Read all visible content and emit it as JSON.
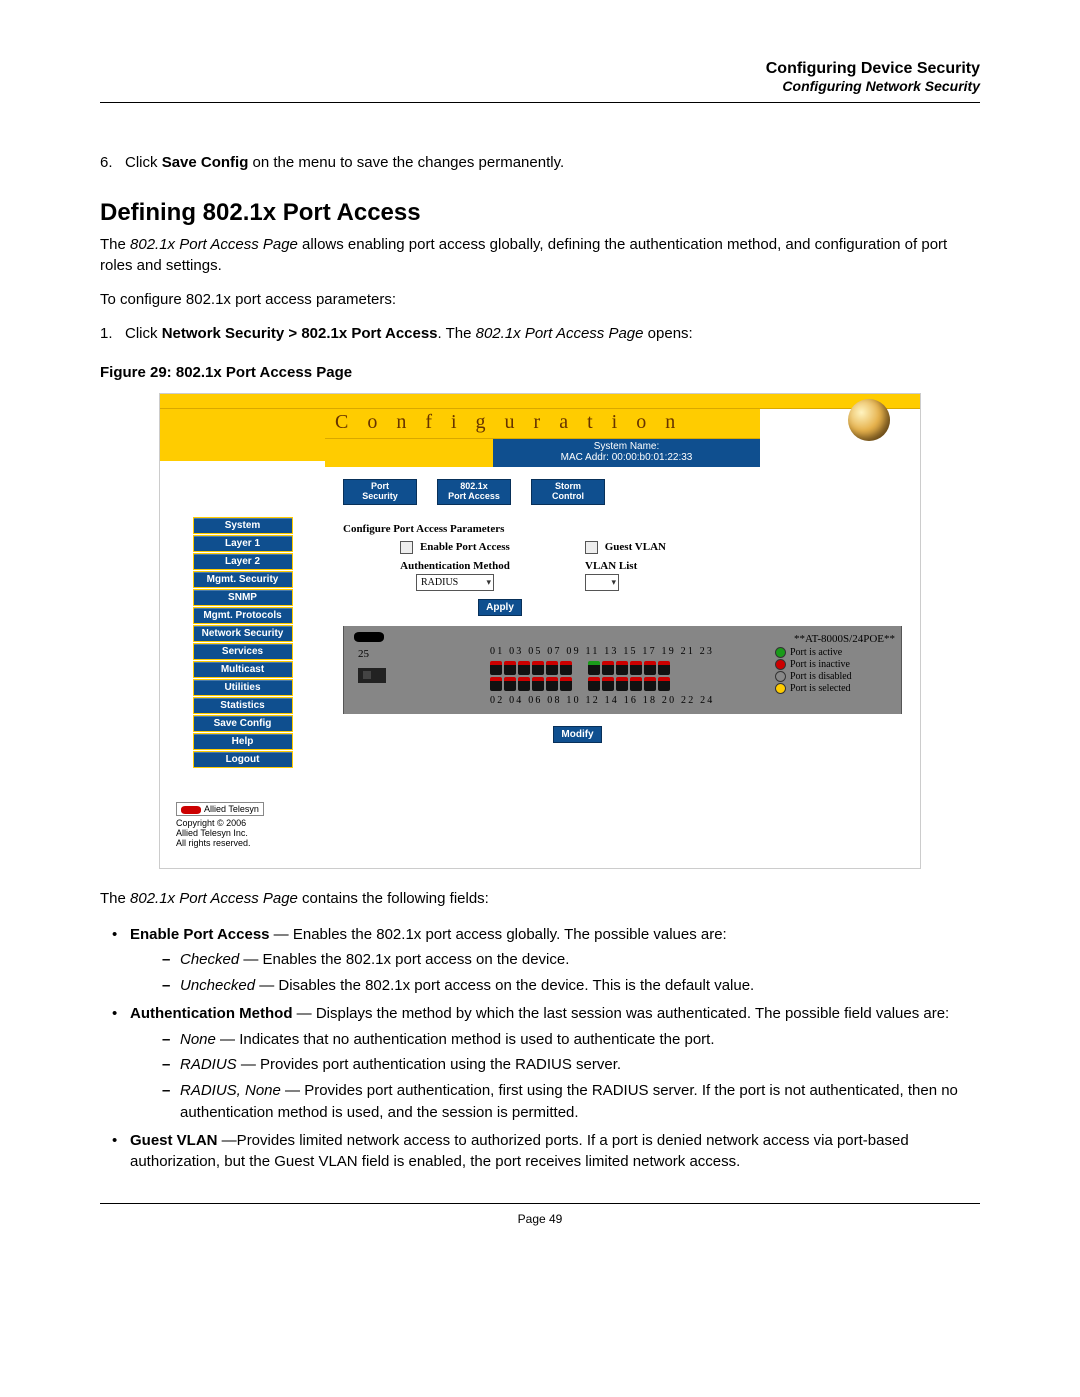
{
  "header": {
    "title": "Configuring Device Security",
    "subtitle": "Configuring Network Security"
  },
  "step6": {
    "prefix": "6.   Click ",
    "bold": "Save Config",
    "suffix": " on the menu to save the changes permanently."
  },
  "section_heading": "Defining 802.1x Port Access",
  "intro": {
    "pre": "The ",
    "ital": "802.1x Port Access Page",
    "post": " allows enabling port access globally, defining the authentication method, and configuration of port roles and settings."
  },
  "to_configure": "To configure 802.1x port access parameters:",
  "step1": {
    "prefix": "1.   Click ",
    "bold": "Network Security > 802.1x Port Access",
    "mid": ". The ",
    "ital": "802.1x Port Access Page",
    "suffix": " opens:"
  },
  "figure_caption": "Figure 29:  802.1x Port Access Page",
  "screenshot": {
    "banner": "C o n f i g u r a t i o n",
    "sys_line1": "System Name:",
    "sys_line2": "MAC Addr:  00:00:b0:01:22:33",
    "tabs": [
      {
        "l1": "Port",
        "l2": "Security"
      },
      {
        "l1": "802.1x",
        "l2": "Port Access"
      },
      {
        "l1": "Storm",
        "l2": "Control"
      }
    ],
    "nav": [
      "System",
      "Layer 1",
      "Layer 2",
      "Mgmt. Security",
      "SNMP",
      "Mgmt. Protocols",
      "Network Security",
      "Services",
      "Multicast",
      "Utilities",
      "Statistics",
      "Save Config",
      "Help",
      "Logout"
    ],
    "form_title": "Configure Port Access Parameters",
    "enable_label": "Enable Port Access",
    "guest_vlan_label": "Guest VLAN",
    "auth_method_label": "Authentication Method",
    "auth_method_value": "RADIUS",
    "vlan_list_label": "VLAN List",
    "apply": "Apply",
    "modify": "Modify",
    "device_model": "**AT-8000S/24POE**",
    "ports_top": "01 03 05 07 09 11   13 15 17 19 21 23",
    "ports_bottom": "02 04 06 08 10 12   14 16 18 20 22 24",
    "slot25": "25",
    "legend": {
      "active": "Port is active",
      "inactive": "Port is inactive",
      "disabled": "Port is disabled",
      "selected": "Port is selected"
    },
    "footer_brand": "Allied Telesyn",
    "footer_copyright": "Copyright © 2006",
    "footer_company": "Allied Telesyn Inc.",
    "footer_rights": "All rights reserved."
  },
  "fields_intro": {
    "pre": "The ",
    "ital": "802.1x Port Access Page",
    "post": " contains the following fields:"
  },
  "bullets": {
    "enable": {
      "label": "Enable Port Access",
      "text": " — Enables the 802.1x port access globally. The possible values are:",
      "sub": [
        {
          "ital": "Checked",
          "text": " — Enables the 802.1x port access on the device."
        },
        {
          "ital": "Unchecked",
          "text": " — Disables the 802.1x port access on the device. This is the default value."
        }
      ]
    },
    "auth": {
      "label": "Authentication Method",
      "text": " — Displays the method by which the last session was authenticated. The possible field values are:",
      "sub": [
        {
          "ital": "None",
          "text": " — Indicates that no authentication method is used to authenticate the port."
        },
        {
          "ital": "RADIUS",
          "text": " — Provides port authentication using the RADIUS server."
        },
        {
          "ital": "RADIUS, None",
          "text": " — Provides port authentication, first using the RADIUS server. If the port is not authenticated, then no authentication method is used, and the session is permitted."
        }
      ]
    },
    "guest": {
      "label": "Guest VLAN",
      "text": " —Provides limited network access to authorized ports. If a port is denied network access via port-based authorization, but the Guest VLAN field is enabled, the port receives limited network access."
    }
  },
  "page_number": "Page 49"
}
